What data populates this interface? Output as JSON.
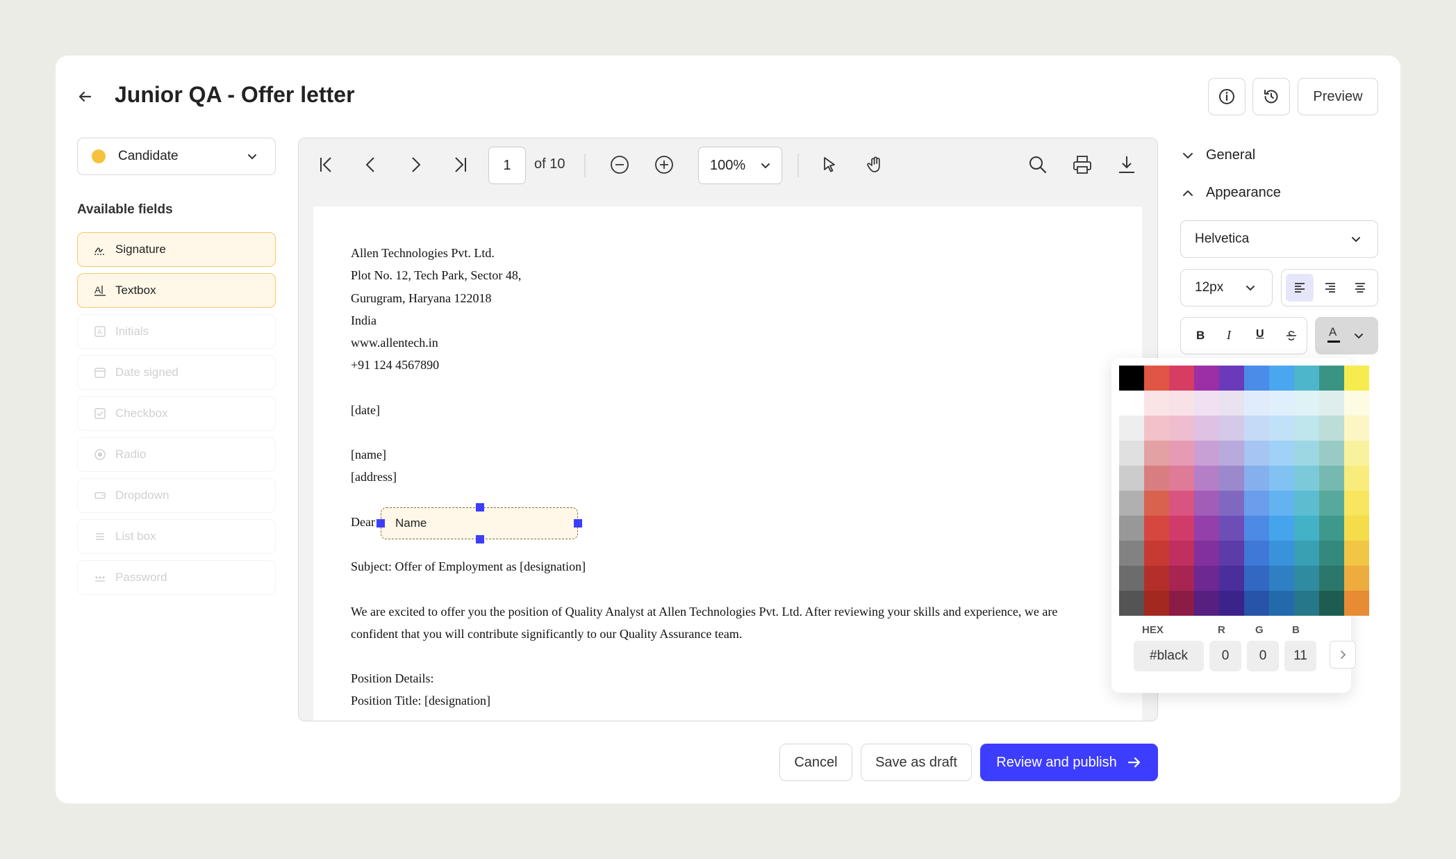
{
  "header": {
    "title": "Junior QA - Offer letter",
    "preview_label": "Preview"
  },
  "left": {
    "role_select": "Candidate",
    "role_color": "#f6c23e",
    "section_title": "Available fields",
    "fields": [
      {
        "label": "Signature",
        "icon": "signature-icon",
        "enabled": true
      },
      {
        "label": "Textbox",
        "icon": "textbox-icon",
        "enabled": true
      },
      {
        "label": "Initials",
        "icon": "initials-icon",
        "enabled": false
      },
      {
        "label": "Date signed",
        "icon": "calendar-icon",
        "enabled": false
      },
      {
        "label": "Checkbox",
        "icon": "checkbox-icon",
        "enabled": false
      },
      {
        "label": "Radio",
        "icon": "radio-icon",
        "enabled": false
      },
      {
        "label": "Dropdown",
        "icon": "dropdown-icon",
        "enabled": false
      },
      {
        "label": "List box",
        "icon": "list-icon",
        "enabled": false
      },
      {
        "label": "Password",
        "icon": "password-icon",
        "enabled": false
      }
    ]
  },
  "viewer": {
    "page_input": "1",
    "page_total": "of 10",
    "zoom": "100%"
  },
  "document": {
    "lines": [
      "Allen Technologies Pvt. Ltd.",
      "Plot No. 12, Tech Park, Sector 48,",
      "Gurugram, Haryana 122018",
      "India",
      "www.allentech.in",
      "+91 124 4567890",
      "[date]",
      "[name]",
      "[address]",
      "Dear",
      "Subject: Offer of Employment as [designation]",
      "We are excited to offer you the position of Quality Analyst at Allen Technologies Pvt. Ltd. After reviewing your skills and experience, we are",
      "confident that you will contribute significantly to our Quality Assurance team.",
      "Position Details:",
      "Position Title: [designation]"
    ],
    "field_placeholder": "Name"
  },
  "right": {
    "general_label": "General",
    "appearance_label": "Appearance",
    "font": "Helvetica",
    "size": "12px",
    "bold": "B",
    "italic": "I",
    "underline": "U",
    "text_color_letter": "A"
  },
  "palette": {
    "hex_label": "HEX",
    "r_label": "R",
    "g_label": "G",
    "b_label": "B",
    "hex_value": "#black",
    "r_value": "0",
    "g_value": "0",
    "b_value": "11",
    "columns": [
      [
        "#000000",
        "#ffffff",
        "#eeeeee",
        "#e0e0e0",
        "#cccccc",
        "#b0b0b0",
        "#989898",
        "#828282",
        "#6c6c6c",
        "#545454"
      ],
      [
        "#e05543",
        "#fbe4e6",
        "#f2c2c8",
        "#e3a1a3",
        "#d97e80",
        "#d9624f",
        "#d5473f",
        "#c73a33",
        "#b42f2b",
        "#a3281f"
      ],
      [
        "#d83c62",
        "#f9e1e8",
        "#efbdd0",
        "#e79ab3",
        "#df7a99",
        "#d95480",
        "#d13b6b",
        "#bf2f5f",
        "#a82453",
        "#8a1c45"
      ],
      [
        "#9c2fa5",
        "#f0e0f1",
        "#dfc1e4",
        "#c9a0d5",
        "#b57fc7",
        "#a15db7",
        "#9540aa",
        "#82309c",
        "#6e2891",
        "#561f80"
      ],
      [
        "#6a3aba",
        "#e8e2f1",
        "#d3c9e8",
        "#b8aadc",
        "#9b89cd",
        "#8068c0",
        "#6c4eb6",
        "#5b3ca9",
        "#4a2f9c",
        "#3b238c"
      ],
      [
        "#4a8de8",
        "#e0ecfb",
        "#c5daf7",
        "#a6c5f2",
        "#86b0ed",
        "#6a9deb",
        "#4c8ae6",
        "#3f78d6",
        "#3268c2",
        "#2753a8"
      ],
      [
        "#4aa6ee",
        "#dfeffc",
        "#c1e1f9",
        "#a0d1f6",
        "#81c2f3",
        "#62b3f0",
        "#45a4ec",
        "#3a92da",
        "#2f7fc4",
        "#236aad"
      ],
      [
        "#4db6ca",
        "#dff2f6",
        "#bfe5ed",
        "#9dd7e3",
        "#7ccad9",
        "#5cbdd0",
        "#43b1c6",
        "#39a0b4",
        "#2f8ba0",
        "#267788"
      ],
      [
        "#3a9484",
        "#deeeec",
        "#bcddd8",
        "#99cbc4",
        "#76b9b0",
        "#58a99d",
        "#3e998c",
        "#34897c",
        "#2b776b",
        "#1f5c50"
      ],
      [
        "#f7ec4e",
        "#fefbe3",
        "#fcf6c4",
        "#faf19f",
        "#f8ec7c",
        "#f7e65e",
        "#f4dc4b",
        "#f1c645",
        "#eeab3e",
        "#e88b35"
      ]
    ]
  },
  "footer": {
    "cancel": "Cancel",
    "save_draft": "Save as draft",
    "publish": "Review and publish"
  },
  "colors": {
    "primary": "#3d3dff",
    "field_bg": "#fff8e8",
    "field_border": "#f4c76a"
  }
}
